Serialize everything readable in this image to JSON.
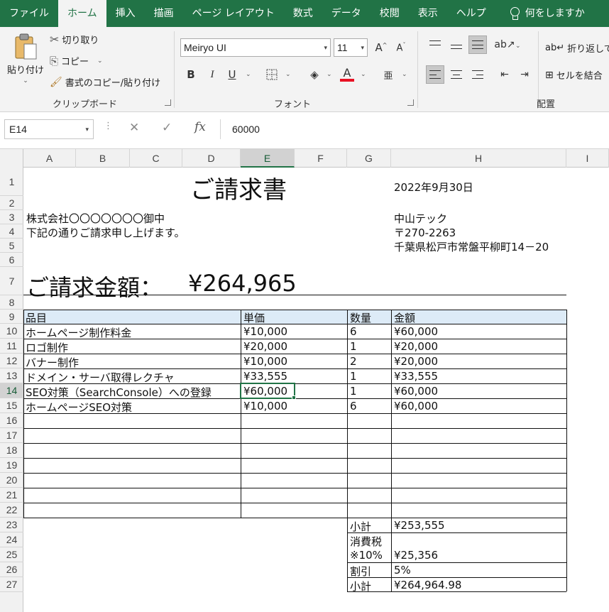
{
  "ribbon": {
    "tabs": [
      "ファイル",
      "ホーム",
      "挿入",
      "描画",
      "ページ レイアウト",
      "数式",
      "データ",
      "校閲",
      "表示",
      "ヘルプ"
    ],
    "active_tab": "ホーム",
    "tell_me": "何をしますか",
    "clipboard": {
      "paste": "貼り付け",
      "cut": "切り取り",
      "copy": "コピー",
      "format_painter": "書式のコピー/貼り付け",
      "label": "クリップボード"
    },
    "font": {
      "name": "Meiryo UI",
      "size": "11",
      "label": "フォント",
      "bold": "B",
      "italic": "I",
      "underline": "U",
      "font_color_swatch": "#e81123"
    },
    "alignment": {
      "wrap_text": "折り返して全",
      "merge": "セルを結合",
      "label": "配置"
    }
  },
  "formula_bar": {
    "name_box": "E14",
    "value": "60000"
  },
  "columns": [
    "A",
    "B",
    "C",
    "D",
    "E",
    "F",
    "G",
    "H",
    "I"
  ],
  "selected_column": "E",
  "selected_row": "14",
  "rows": [
    "1",
    "2",
    "3",
    "4",
    "5",
    "6",
    "7",
    "8",
    "9",
    "10",
    "11",
    "12",
    "13",
    "14",
    "15",
    "16",
    "17",
    "18",
    "19",
    "20",
    "21",
    "22",
    "23",
    "24",
    "25",
    "26",
    "27"
  ],
  "invoice": {
    "title": "ご請求書",
    "date": "2022年9月30日",
    "recipient": "株式会社〇〇〇〇〇〇〇御中",
    "message": "下記の通りご請求申し上げます。",
    "sender_name": "中山テック",
    "postal": "〒270-2263",
    "address": "千葉県松戸市常盤平柳町14－20",
    "amount_label": "ご請求金額：",
    "amount_value": "¥264,965",
    "headers": {
      "item": "品目",
      "unit_price": "単価",
      "qty": "数量",
      "amount": "金額"
    },
    "items": [
      {
        "item": "ホームページ制作料金",
        "unit_price": "¥10,000",
        "qty": "6",
        "amount": "¥60,000"
      },
      {
        "item": "ロゴ制作",
        "unit_price": "¥20,000",
        "qty": "1",
        "amount": "¥20,000"
      },
      {
        "item": "バナー制作",
        "unit_price": "¥10,000",
        "qty": "2",
        "amount": "¥20,000"
      },
      {
        "item": "ドメイン・サーバ取得レクチャ",
        "unit_price": "¥33,555",
        "qty": "1",
        "amount": "¥33,555"
      },
      {
        "item": "SEO対策（SearchConsole）への登録",
        "unit_price": "¥60,000",
        "qty": "1",
        "amount": "¥60,000"
      },
      {
        "item": "ホームページSEO対策",
        "unit_price": "¥10,000",
        "qty": "6",
        "amount": "¥60,000"
      }
    ],
    "subtotal_label": "小計",
    "subtotal_value": "¥253,555",
    "tax_label_1": "消費税",
    "tax_label_2": "※10%",
    "tax_value": "¥25,356",
    "discount_label": "割引",
    "discount_value": "5%",
    "total_label": "小計",
    "total_value": "¥264,964.98"
  }
}
